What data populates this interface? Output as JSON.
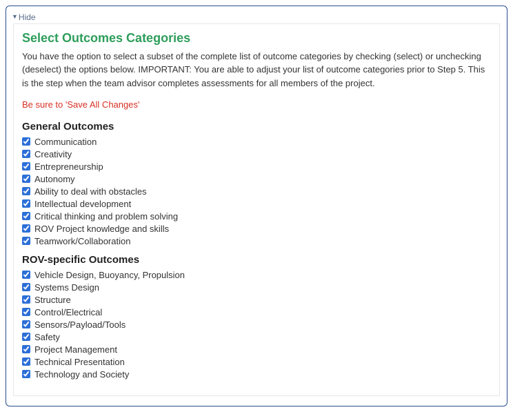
{
  "toggle": {
    "label": "Hide"
  },
  "header": {
    "title": "Select Outcomes Categories",
    "description": "You have the option to select a subset of the complete list of outcome categories by checking (select) or unchecking (deselect) the options below. IMPORTANT: You are able to adjust your list of outcome categories prior to Step 5. This is the step when the team advisor completes assessments for all members of the project.",
    "warning": "Be sure to 'Save All Changes'"
  },
  "sections": {
    "general": {
      "heading": "General Outcomes",
      "items": [
        "Communication",
        "Creativity",
        "Entrepreneurship",
        "Autonomy",
        "Ability to deal with obstacles",
        "Intellectual development",
        "Critical thinking and problem solving",
        "ROV Project knowledge and skills",
        "Teamwork/Collaboration"
      ]
    },
    "rov": {
      "heading": "ROV-specific Outcomes",
      "items": [
        "Vehicle Design, Buoyancy, Propulsion",
        "Systems Design",
        "Structure",
        "Control/Electrical",
        "Sensors/Payload/Tools",
        "Safety",
        "Project Management",
        "Technical Presentation",
        "Technology and Society"
      ]
    }
  }
}
